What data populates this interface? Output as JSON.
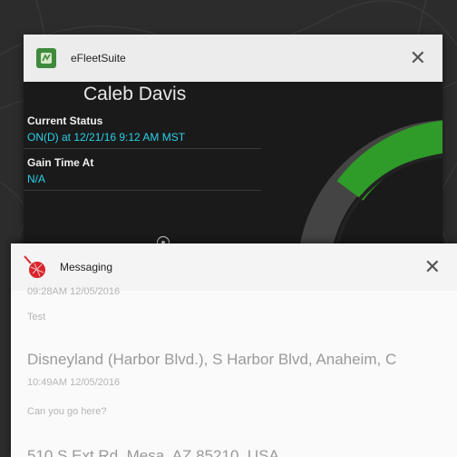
{
  "colors": {
    "accent_cyan": "#2ad0e8",
    "gauge_green": "#2f9b28",
    "brand_green": "#3f8a3c",
    "messaging_red": "#d8262e"
  },
  "efleet": {
    "app_title": "eFleetSuite",
    "driver_name": "Caleb Davis",
    "current_status_label": "Current Status",
    "current_status_value": "ON(D) at 12/21/16 9:12 AM MST",
    "gain_time_label": "Gain Time At",
    "gain_time_value": "N/A",
    "close_icon": "close-icon",
    "expand_icon": "expand-icon"
  },
  "messaging": {
    "app_title": "Messaging",
    "close_icon": "close-icon",
    "messages": [
      {
        "time": "09:28AM 12/05/2016",
        "text": "Test"
      },
      {
        "location": "Disneyland (Harbor Blvd.), S Harbor Blvd, Anaheim, C",
        "time": "10:49AM 12/05/2016",
        "text": "Can you go here?"
      },
      {
        "location": "510 S Ext Rd, Mesa, AZ 85210, USA"
      }
    ]
  }
}
